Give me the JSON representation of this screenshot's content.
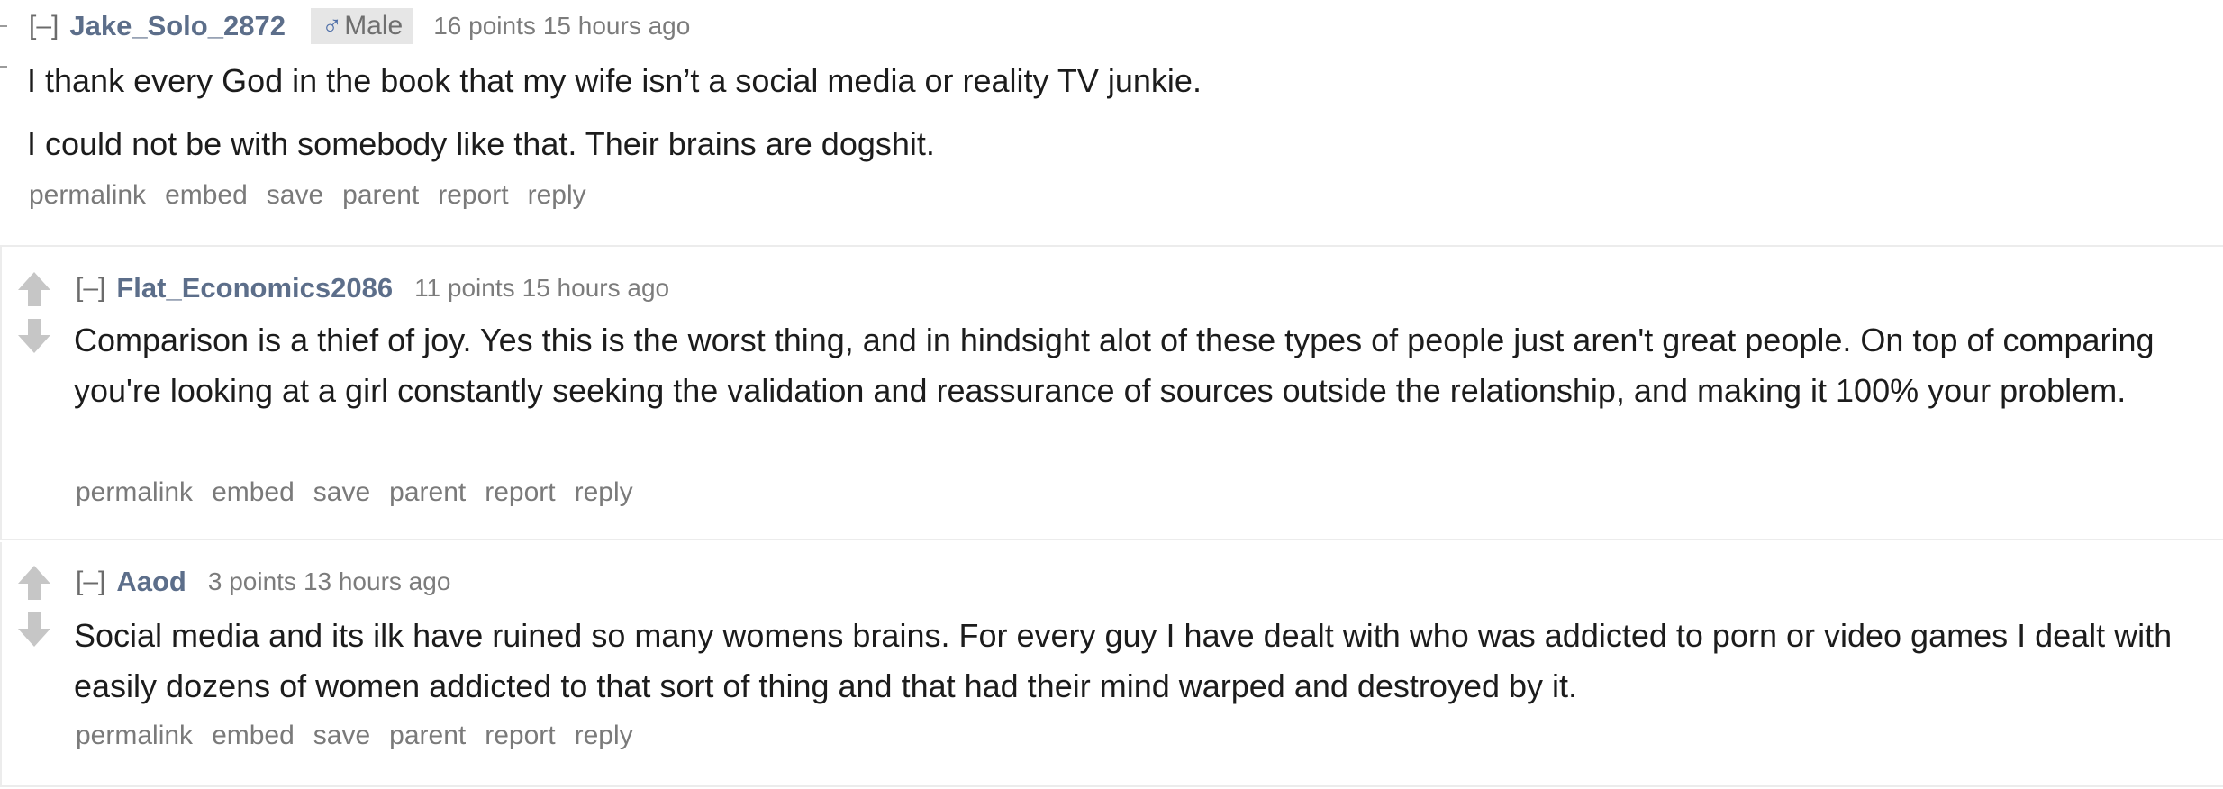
{
  "comments": [
    {
      "expand": "[–]",
      "author": "Jake_Solo_2872",
      "flair": {
        "glyph": "♂",
        "text": "Male"
      },
      "score": "16 points",
      "time": "15 hours ago",
      "body": [
        "I thank every God in the book that my wife isn’t a social media or reality TV junkie.",
        "I could not be with somebody like that. Their brains are dogshit."
      ]
    },
    {
      "expand": "[–]",
      "author": "Flat_Economics2086",
      "score": "11 points",
      "time": "15 hours ago",
      "body": [
        "Comparison is a thief of joy. Yes this is the worst thing, and in hindsight alot of these types of people just aren't great people. On top of comparing you're looking at a girl constantly seeking the validation and reassurance of sources outside the relationship, and making it 100% your problem."
      ]
    },
    {
      "expand": "[–]",
      "author": "Aaod",
      "score": "3 points",
      "time": "13 hours ago",
      "body": [
        "Social media and its ilk have ruined so many womens brains. For every guy I have dealt with who was addicted to porn or video games I dealt with easily dozens of women addicted to that sort of thing and that had their mind warped and destroyed by it."
      ]
    }
  ],
  "actions": [
    "permalink",
    "embed",
    "save",
    "parent",
    "report",
    "reply"
  ],
  "colors": {
    "author": "#5c6e8a",
    "meta": "#7c7c7c",
    "vote_arrow": "#c6c6c6",
    "divider": "#ececec"
  },
  "icons": {
    "upvote": "upvote-arrow-icon",
    "downvote": "downvote-arrow-icon"
  }
}
